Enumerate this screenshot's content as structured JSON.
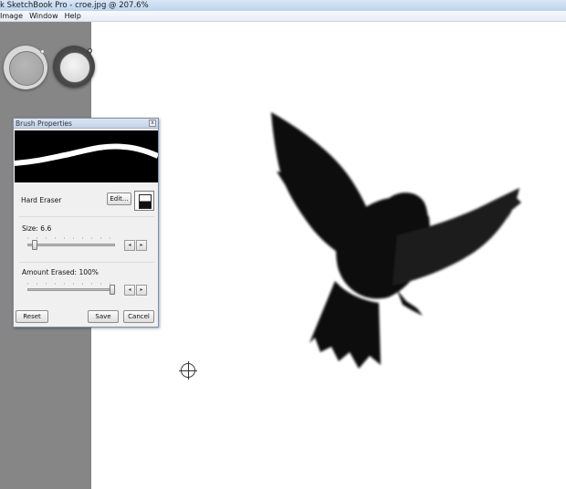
{
  "window": {
    "title": "k SketchBook Pro - croe.jpg @ 207.6%"
  },
  "menu": {
    "items": [
      "Image",
      "Window",
      "Help"
    ]
  },
  "brush_properties": {
    "title": "Brush Properties",
    "close_glyph": "x",
    "brush_name": "Hard Eraser",
    "edit_label": "Edit...",
    "size_label": "Size: 6.6",
    "size_fraction": 0.05,
    "amount_label": "Amount Erased: 100%",
    "amount_fraction": 1.0,
    "step_left": "◂",
    "step_right": "▸",
    "reset_label": "Reset",
    "save_label": "Save",
    "cancel_label": "Cancel"
  },
  "colors": {
    "left_panel": "#868686",
    "canvas": "#ffffff",
    "crow": "#0b0b0b"
  },
  "icons": [
    "color-puck-icon",
    "brush-puck-icon",
    "eraser-swatch-icon",
    "brush-cursor-icon",
    "close-icon"
  ]
}
